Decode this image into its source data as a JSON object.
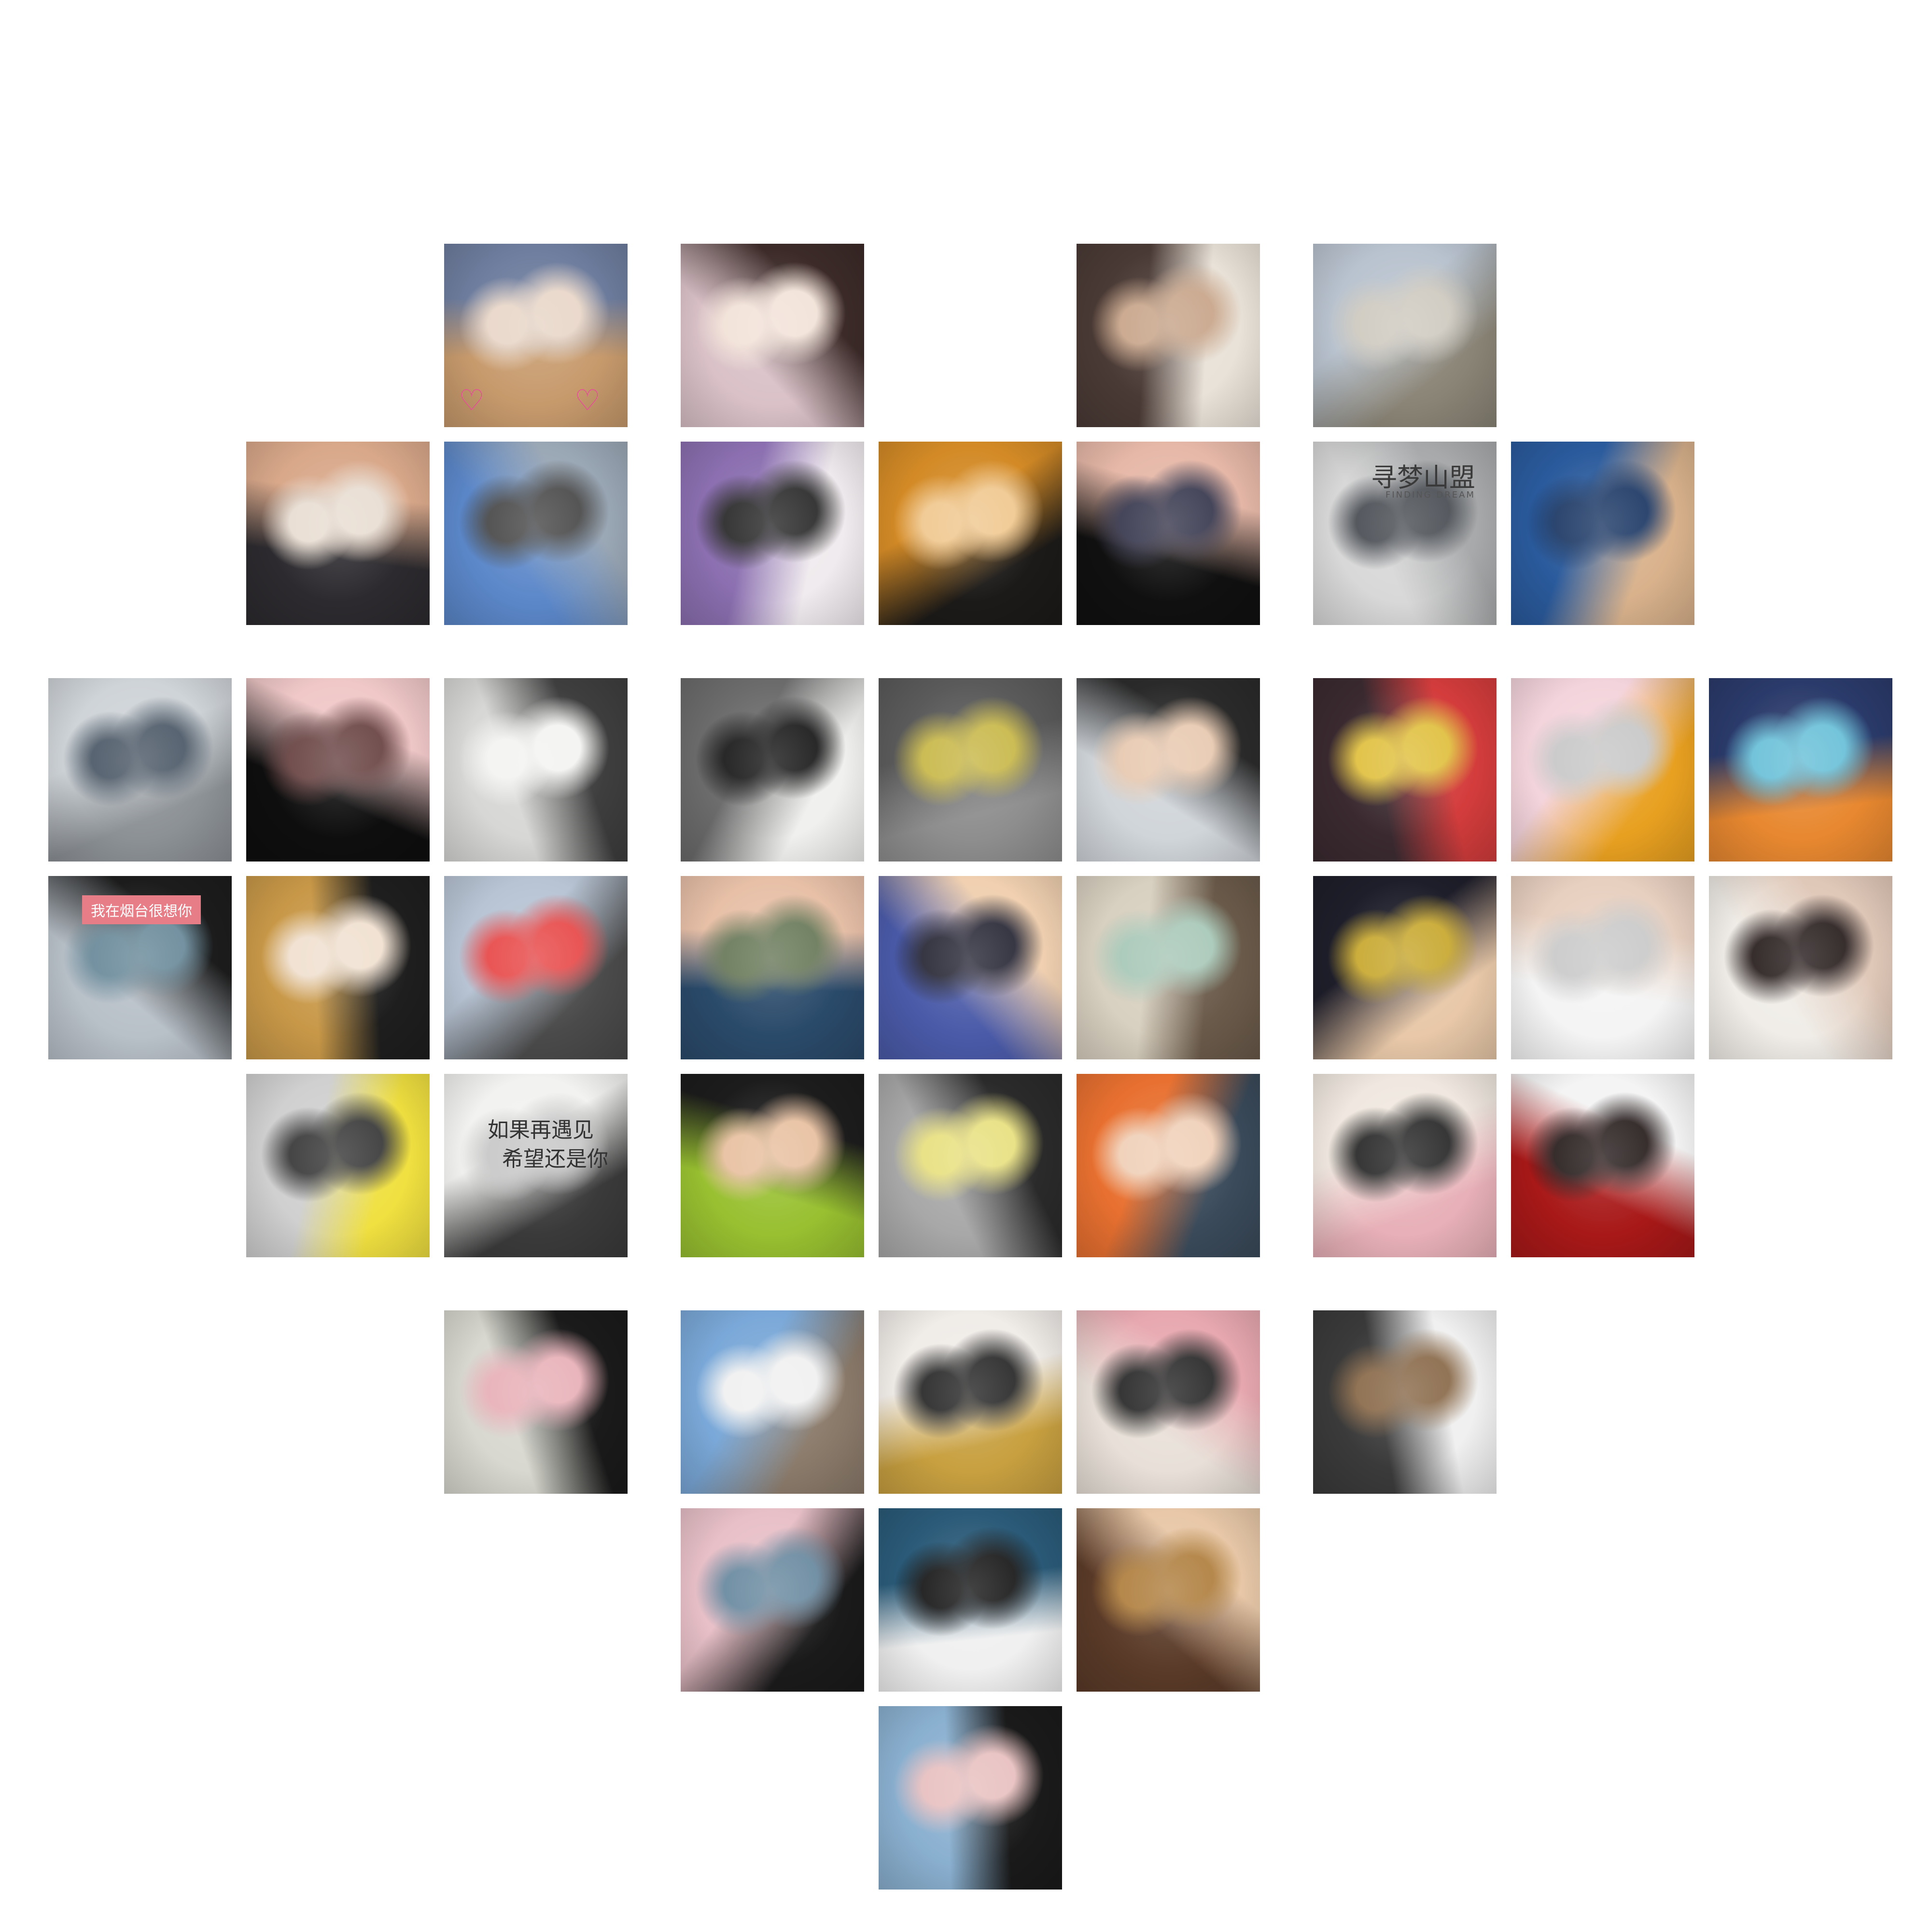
{
  "texts": {
    "shanhai_title": "寻梦山盟",
    "shanhai_sub": "FINDING DREAM",
    "yantai_sign": "我在烟台很想你",
    "wall_line_1": "如果再遇见",
    "wall_line_2": "希望还是你"
  },
  "photos": [
    {
      "col": 3,
      "row": 1,
      "colors": [
        "#c79a6c",
        "#6e7d9e",
        "#e8d6c8"
      ]
    },
    {
      "col": 4,
      "row": 1,
      "colors": [
        "#d9c1c7",
        "#3b2a28",
        "#f2e2d8"
      ]
    },
    {
      "col": 6,
      "row": 1,
      "colors": [
        "#4a3a35",
        "#e9e2d8",
        "#c8a58a"
      ]
    },
    {
      "col": 7,
      "row": 1,
      "colors": [
        "#b9c3cf",
        "#8a8476",
        "#cfcac0"
      ]
    },
    {
      "col": 2,
      "row": 2,
      "colors": [
        "#2c2a2e",
        "#d9a88a",
        "#e8ddd2"
      ]
    },
    {
      "col": 3,
      "row": 2,
      "colors": [
        "#5b87c9",
        "#9aa7b5",
        "#4a4a4a"
      ]
    },
    {
      "col": 4,
      "row": 2,
      "colors": [
        "#8b6fb0",
        "#f0ebee",
        "#2b2b2b"
      ]
    },
    {
      "col": 5,
      "row": 2,
      "colors": [
        "#d38a26",
        "#1c1a18",
        "#f0c890"
      ]
    },
    {
      "col": 6,
      "row": 2,
      "colors": [
        "#101010",
        "#e6b8a8",
        "#3a3a50"
      ]
    },
    {
      "col": 7,
      "row": 2,
      "colors": [
        "#d8d8d8",
        "#a7a9aa",
        "#4b4f55"
      ],
      "sign": "shanhai"
    },
    {
      "col": 8,
      "row": 2,
      "colors": [
        "#2a5a9c",
        "#d9b28c",
        "#1e3a66"
      ]
    },
    {
      "col": 1,
      "row": 3,
      "colors": [
        "#cfd4d8",
        "#8c9196",
        "#4d5a68"
      ]
    },
    {
      "col": 2,
      "row": 3,
      "colors": [
        "#0e0e0e",
        "#f0c8c8",
        "#6a4444"
      ]
    },
    {
      "col": 3,
      "row": 3,
      "colors": [
        "#d7d7d5",
        "#3e3e3e",
        "#f3f3f1"
      ]
    },
    {
      "col": 4,
      "row": 3,
      "colors": [
        "#6b6b6b",
        "#f0f0ee",
        "#1b1b1b"
      ]
    },
    {
      "col": 5,
      "row": 3,
      "colors": [
        "#5a5a5a",
        "#8e8e8e",
        "#c8b84a"
      ]
    },
    {
      "col": 6,
      "row": 3,
      "colors": [
        "#d0d5da",
        "#2a2a2a",
        "#e8c9b0"
      ]
    },
    {
      "col": 7,
      "row": 3,
      "colors": [
        "#3a2a30",
        "#d43c3c",
        "#e0c040"
      ]
    },
    {
      "col": 8,
      "row": 3,
      "colors": [
        "#f4d4dc",
        "#e8a020",
        "#c8c8c8"
      ]
    },
    {
      "col": 9,
      "row": 3,
      "colors": [
        "#2a3a6a",
        "#e88830",
        "#6ac0d8"
      ]
    },
    {
      "col": 1,
      "row": 4,
      "colors": [
        "#b8c0c8",
        "#1c1c1c",
        "#6a8a9a"
      ],
      "sign": "yantai"
    },
    {
      "col": 2,
      "row": 4,
      "colors": [
        "#c89848",
        "#1e1e1e",
        "#f0e0d0"
      ]
    },
    {
      "col": 3,
      "row": 4,
      "colors": [
        "#b8c4d4",
        "#4a4a4a",
        "#e84a4a"
      ]
    },
    {
      "col": 4,
      "row": 4,
      "colors": [
        "#2a4a6a",
        "#e8c0a8",
        "#6a7a5a"
      ]
    },
    {
      "col": 5,
      "row": 4,
      "colors": [
        "#4a5aa8",
        "#f0d0b0",
        "#2a2a38"
      ]
    },
    {
      "col": 6,
      "row": 4,
      "colors": [
        "#d8d0c0",
        "#6a5a4a",
        "#a8c8b8"
      ]
    },
    {
      "col": 7,
      "row": 4,
      "colors": [
        "#1e1e2a",
        "#e8c8a8",
        "#c8a830"
      ]
    },
    {
      "col": 8,
      "row": 4,
      "colors": [
        "#f4f4f4",
        "#e8d0c0",
        "#cacaca"
      ]
    },
    {
      "col": 9,
      "row": 4,
      "colors": [
        "#f0ede8",
        "#e0c8b8",
        "#2a2020"
      ]
    },
    {
      "col": 2,
      "row": 5,
      "colors": [
        "#d0d0d0",
        "#f0e040",
        "#3a3a3a"
      ]
    },
    {
      "col": 3,
      "row": 5,
      "colors": [
        "#f2f2f0",
        "#3a3a3a",
        "#c8c8c8"
      ],
      "sign": "wall"
    },
    {
      "col": 4,
      "row": 5,
      "colors": [
        "#98c030",
        "#1c1c1c",
        "#e8c0a0"
      ]
    },
    {
      "col": 5,
      "row": 5,
      "colors": [
        "#a8a8a8",
        "#2a2a2a",
        "#e8e080"
      ]
    },
    {
      "col": 6,
      "row": 5,
      "colors": [
        "#e87030",
        "#3a4a5a",
        "#f0d0b8"
      ]
    },
    {
      "col": 7,
      "row": 5,
      "colors": [
        "#f0e8e0",
        "#e8b0b8",
        "#2a2a2a"
      ]
    },
    {
      "col": 8,
      "row": 5,
      "colors": [
        "#a81818",
        "#f4f4f4",
        "#2a2020"
      ]
    },
    {
      "col": 3,
      "row": 6,
      "colors": [
        "#d8d8d0",
        "#1a1a1a",
        "#e8b0b8"
      ]
    },
    {
      "col": 4,
      "row": 6,
      "colors": [
        "#7aa8d8",
        "#8a7a6a",
        "#f0f0f0"
      ]
    },
    {
      "col": 5,
      "row": 6,
      "colors": [
        "#f0ece8",
        "#c8a040",
        "#2a2a2a"
      ]
    },
    {
      "col": 6,
      "row": 6,
      "colors": [
        "#e8e0d8",
        "#e8a8b0",
        "#2a2a2a"
      ]
    },
    {
      "col": 7,
      "row": 6,
      "colors": [
        "#3a3a3a",
        "#f0f0f0",
        "#8a6a4a"
      ]
    },
    {
      "col": 4,
      "row": 7,
      "colors": [
        "#e8c0c8",
        "#1a1a1a",
        "#6a8aa0"
      ]
    },
    {
      "col": 5,
      "row": 7,
      "colors": [
        "#2a5a78",
        "#f0f0f0",
        "#1a1a1a"
      ]
    },
    {
      "col": 6,
      "row": 7,
      "colors": [
        "#5a3a28",
        "#e8c8a8",
        "#b08040"
      ]
    },
    {
      "col": 5,
      "row": 8,
      "colors": [
        "#8ab0d0",
        "#1a1a1a",
        "#e8c0c0"
      ]
    }
  ]
}
